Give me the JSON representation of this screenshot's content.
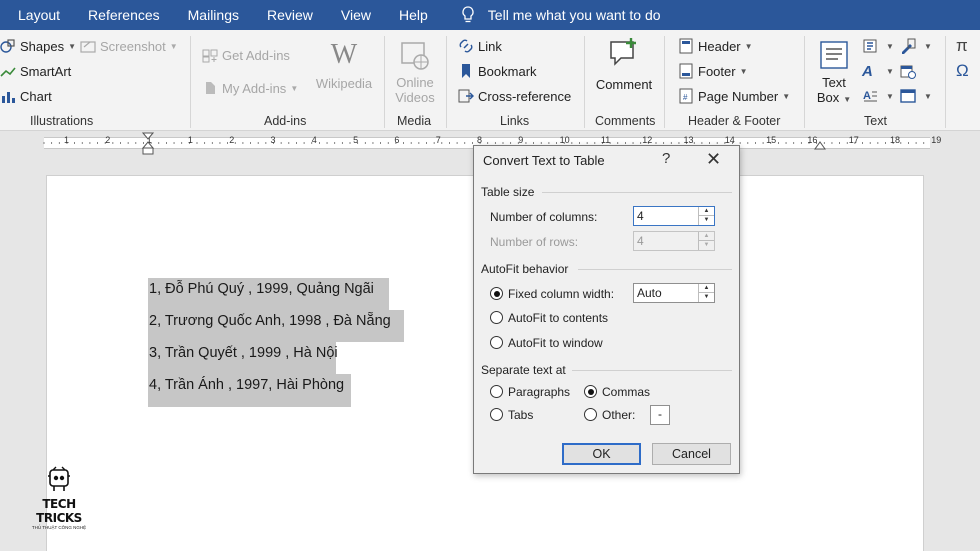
{
  "tabs": [
    "Layout",
    "References",
    "Mailings",
    "Review",
    "View",
    "Help"
  ],
  "tell_me": "Tell me what you want to do",
  "ribbon": {
    "illustrations": {
      "shapes": "Shapes",
      "screenshot": "Screenshot",
      "smartart": "SmartArt",
      "chart": "Chart",
      "label": "Illustrations"
    },
    "addins": {
      "get": "Get Add-ins",
      "my": "My Add-ins",
      "wikipedia": "Wikipedia",
      "label": "Add-ins"
    },
    "media": {
      "online1": "Online",
      "online2": "Videos",
      "label": "Media"
    },
    "links": {
      "link": "Link",
      "bookmark": "Bookmark",
      "crossref": "Cross-reference",
      "label": "Links"
    },
    "comments": {
      "comment": "Comment",
      "label": "Comments"
    },
    "headerfooter": {
      "header": "Header",
      "footer": "Footer",
      "pagenumber": "Page Number",
      "label": "Header & Footer"
    },
    "text": {
      "textbox1": "Text",
      "textbox2": "Box",
      "label": "Text"
    }
  },
  "ruler_numbers": [
    "1",
    "2",
    "1",
    "1",
    "2",
    "3",
    "4",
    "5",
    "6",
    "7",
    "8",
    "9",
    "10",
    "11",
    "12",
    "13",
    "14",
    "15",
    "16",
    "17",
    "18",
    "19"
  ],
  "document": {
    "lines": [
      "1,  Đỗ Phú Quý ,  1999,  Quảng Ngãi",
      "2,  Trương Quốc Anh,  1998 ,  Đà Nẵng",
      "3, Trần Quyết , 1999 , Hà Nội",
      "4, Trần Ánh , 1997, Hài Phòng"
    ]
  },
  "logo": {
    "name": "TECH TRICKS",
    "tagline": "THỦ THUẬT CÔNG NGHỆ"
  },
  "dialog": {
    "title": "Convert Text to Table",
    "help": "?",
    "close": "✕",
    "table_size": "Table size",
    "num_columns_label": "Number of columns:",
    "num_columns_value": "4",
    "num_rows_label": "Number of rows:",
    "num_rows_value": "4",
    "autofit_behavior": "AutoFit behavior",
    "fixed_width_label": "Fixed column width:",
    "fixed_width_value": "Auto",
    "autofit_contents": "AutoFit to contents",
    "autofit_window": "AutoFit to window",
    "separate_text": "Separate text at",
    "paragraphs": "Paragraphs",
    "commas": "Commas",
    "tabs": "Tabs",
    "other": "Other:",
    "other_value": "-",
    "ok": "OK",
    "cancel": "Cancel"
  }
}
